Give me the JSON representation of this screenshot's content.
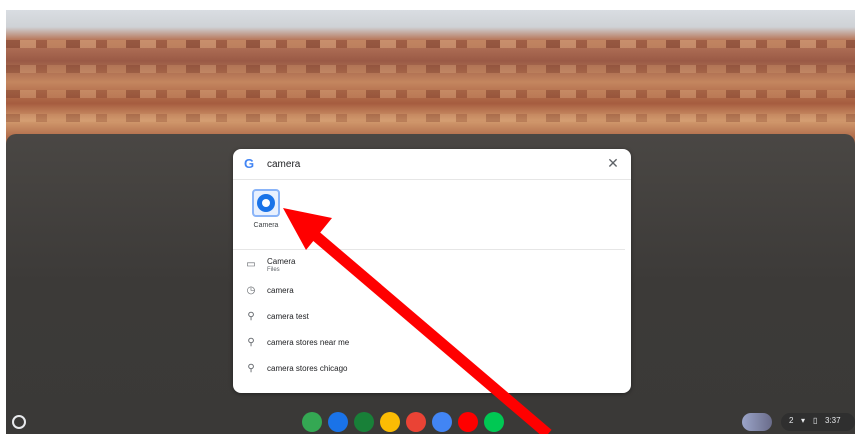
{
  "search": {
    "value": "camera",
    "google_logo_text": "G",
    "close_glyph": "✕"
  },
  "app_result": {
    "label": "Camera",
    "icon": "camera-icon"
  },
  "results": [
    {
      "icon": "folder-icon",
      "glyph": "▭",
      "title": "Camera",
      "subtitle": "Files"
    },
    {
      "icon": "history-icon",
      "glyph": "◷",
      "title": "camera",
      "subtitle": ""
    },
    {
      "icon": "search-icon",
      "glyph": "⚲",
      "title": "camera test",
      "subtitle": ""
    },
    {
      "icon": "search-icon",
      "glyph": "⚲",
      "title": "camera stores near me",
      "subtitle": ""
    },
    {
      "icon": "search-icon",
      "glyph": "⚲",
      "title": "camera stores chicago",
      "subtitle": ""
    }
  ],
  "shelf": {
    "apps": [
      {
        "name": "google-drive-icon",
        "color": "#34a853"
      },
      {
        "name": "meet-icon",
        "color": "#1a73e8"
      },
      {
        "name": "classroom-icon",
        "color": "#188038"
      },
      {
        "name": "chrome-icon",
        "color": "#fbbc04"
      },
      {
        "name": "gmail-icon",
        "color": "#ea4335"
      },
      {
        "name": "docs-icon",
        "color": "#4285f4"
      },
      {
        "name": "youtube-icon",
        "color": "#ff0000"
      },
      {
        "name": "play-store-icon",
        "color": "#00c853"
      }
    ],
    "notification_count": "2",
    "time": "3:37"
  },
  "annotation": {
    "arrow_color": "#ff0000"
  }
}
